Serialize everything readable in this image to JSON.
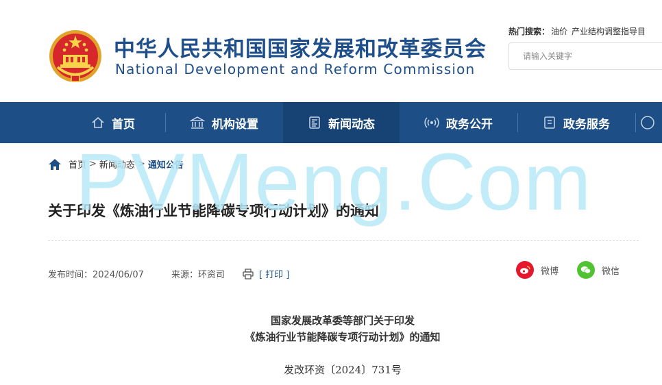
{
  "header": {
    "title_cn": "中华人民共和国国家发展和改革委员会",
    "title_en": "National Development and Reform Commission",
    "hot_label": "热门搜索：",
    "hot_terms": [
      "油价",
      "产业结构调整指导目"
    ],
    "search_placeholder": "请输入关键字"
  },
  "nav": {
    "items": [
      {
        "label": "首页",
        "icon": "home-icon"
      },
      {
        "label": "机构设置",
        "icon": "institution-icon"
      },
      {
        "label": "新闻动态",
        "icon": "news-icon"
      },
      {
        "label": "政务公开",
        "icon": "broadcast-icon"
      },
      {
        "label": "政务服务",
        "icon": "document-icon"
      }
    ],
    "active": "新闻动态"
  },
  "breadcrumb": [
    "首页",
    "新闻动态",
    "通知公告"
  ],
  "watermark": "PVMeng.Com",
  "article": {
    "title": "关于印发《炼油行业节能降碳专项行动计划》的通知",
    "publish_time": "发布时间：2024/06/07",
    "source": "来源：环资司",
    "print_label": "[ 打印 ]",
    "share": [
      {
        "label": "微博",
        "icon": "weibo-icon",
        "color": "#e6162d"
      },
      {
        "label": "微信",
        "icon": "wechat-icon",
        "color": "#51c332"
      }
    ],
    "doc_heading_1": "国家发展改革委等部门关于印发",
    "doc_heading_2": "《炼油行业节能降碳专项行动计划》的通知",
    "doc_number": "发改环资〔2024〕731号"
  },
  "colors": {
    "brand_blue": "#1d4f86",
    "nav_active": "#164373",
    "watermark": "#b9e9f9"
  }
}
